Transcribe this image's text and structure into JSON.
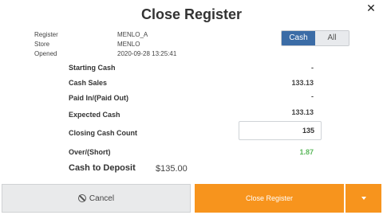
{
  "dialog": {
    "title": "Close Register"
  },
  "meta": {
    "register_label": "Register",
    "register_value": "MENLO_A",
    "store_label": "Store",
    "store_value": "MENLO",
    "opened_label": "Opened",
    "opened_value": "2020-09-28 13:25:41"
  },
  "toggle": {
    "cash_label": "Cash",
    "all_label": "All",
    "selected": "Cash",
    "active_color": "#3b6ca6"
  },
  "rows": {
    "starting_cash_label": "Starting Cash",
    "starting_cash_value": "-",
    "cash_sales_label": "Cash Sales",
    "cash_sales_value": "133.13",
    "paid_in_out_label": "Paid In/(Paid Out)",
    "paid_in_out_value": "-",
    "expected_cash_label": "Expected Cash",
    "expected_cash_value": "133.13",
    "closing_count_label": "Closing Cash  Count",
    "closing_count_value": "135",
    "over_short_label": "Over/(Short)",
    "over_short_value": "1.87",
    "over_short_color": "#5cb85c"
  },
  "deposit": {
    "label": "Cash to Deposit",
    "value": "$135.00"
  },
  "footer": {
    "cancel_label": "Cancel",
    "close_label": "Close Register",
    "primary_color": "#f7941d"
  },
  "icons": {
    "close": "close-icon",
    "cancel": "ban-icon",
    "dropdown": "chevron-down-icon"
  }
}
